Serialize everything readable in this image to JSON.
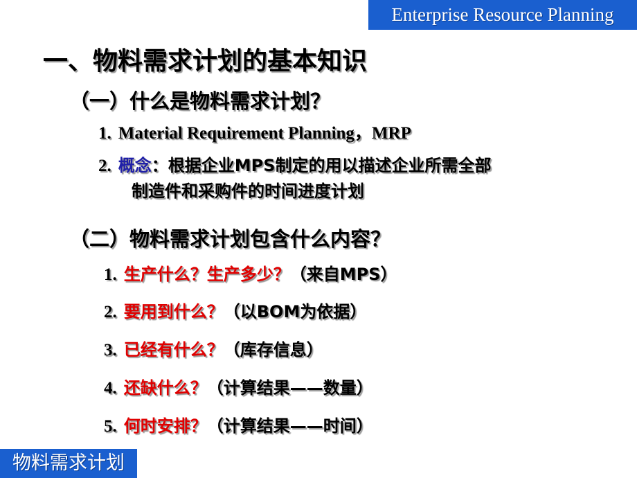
{
  "header_banner": "Enterprise Resource Planning",
  "footer_banner": "物料需求计划",
  "title": "一、物料需求计划的基本知识",
  "section1": {
    "heading": "（一）什么是物料需求计划？",
    "item1": {
      "num": "1.",
      "text": "Material Requirement Planning，MRP"
    },
    "item2": {
      "num": "2.",
      "term": "概念",
      "colon": "：",
      "text_line1": "根据企业MPS制定的用以描述企业所需全部",
      "text_line2": "制造件和采购件的时间进度计划"
    }
  },
  "section2": {
    "heading": "（二）物料需求计划包含什么内容？",
    "items": [
      {
        "num": "1.",
        "question": "生产什么？生产多少？",
        "note": "（来自MPS）"
      },
      {
        "num": "2.",
        "question": "要用到什么？",
        "note": "（以BOM为依据）"
      },
      {
        "num": "3.",
        "question": "已经有什么？",
        "note": "（库存信息）"
      },
      {
        "num": "4.",
        "question": "还缺什么？",
        "note": "（计算结果——数量）"
      },
      {
        "num": "5.",
        "question": "何时安排？",
        "note": "（计算结果——时间）"
      }
    ]
  },
  "colors": {
    "banner": "#1a5fcf",
    "term": "#1f1fa8",
    "question": "#e00000"
  }
}
